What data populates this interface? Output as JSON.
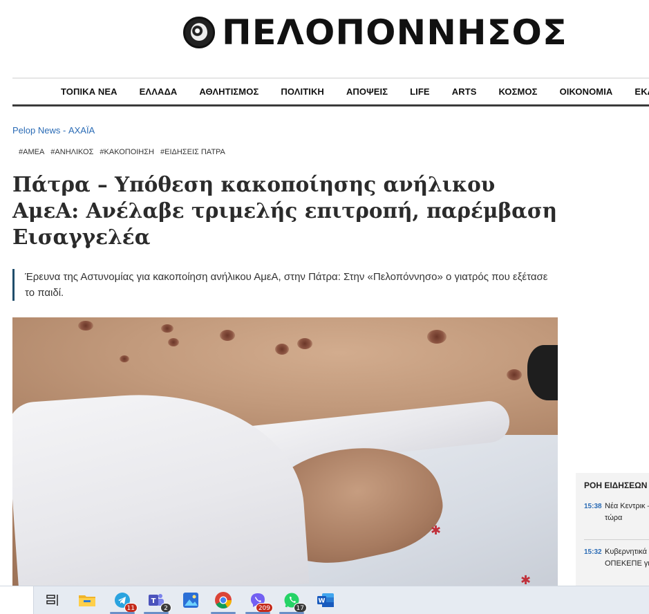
{
  "site": {
    "logo_text": "ΠΕΛΟΠΟΝΝΗΣΟΣ"
  },
  "nav": {
    "items": [
      "ΤΟΠΙΚΑ ΝΕΑ",
      "ΕΛΛΑΔΑ",
      "ΑΘΛΗΤΙΣΜΟΣ",
      "ΠΟΛΙΤΙΚΗ",
      "ΑΠΟΨΕΙΣ",
      "LIFE",
      "ARTS",
      "ΚΟΣΜΟΣ",
      "ΟΙΚΟΝΟΜΙΑ",
      "ΕΚΔ"
    ]
  },
  "breadcrumb": {
    "home": "Pelop News",
    "separator": " - ",
    "section": "ΑΧΑΪΑ"
  },
  "tags": [
    "#ΑΜΕΑ",
    "#ΑΝΗΛΙΚΟΣ",
    "#ΚΑΚΟΠΟΙΗΣΗ",
    "#ΕΙΔΗΣΕΙΣ ΠΑΤΡΑ"
  ],
  "article": {
    "headline": "Πάτρα – Υπόθεση κακοποίησης ανήλικου ΑμεΑ: Ανέλαβε τριμελής επιτροπή, παρέμβαση Εισαγγελέα",
    "lead": "Έρευνα της Αστυνομίας για κακοποίηση ανήλικου ΑμεΑ, στην Πάτρα: Στην «Πελοπόννησο» ο γιατρός που εξέτασε το παιδί."
  },
  "feed": {
    "title": "ΡΟΗ ΕΙΔΗΣΕΩΝ",
    "items": [
      {
        "time": "15:38",
        "text": "Νέα Κεντρικ – Σοφία Σιδέ ξεκινά τώρα"
      },
      {
        "time": "15:32",
        "text": "Κυβερνητικά ΠΑΣΟΚ: Οι τ ΟΠΕΚΕΠΕ γι"
      }
    ]
  },
  "taskbar": {
    "badges": {
      "telegram": "11",
      "teams": "2",
      "viber": "209",
      "whatsapp": "17"
    }
  },
  "colors": {
    "link": "#2a6bb5",
    "lead_bar": "#1f4d6b",
    "nav_rule": "#3a3a3a"
  }
}
